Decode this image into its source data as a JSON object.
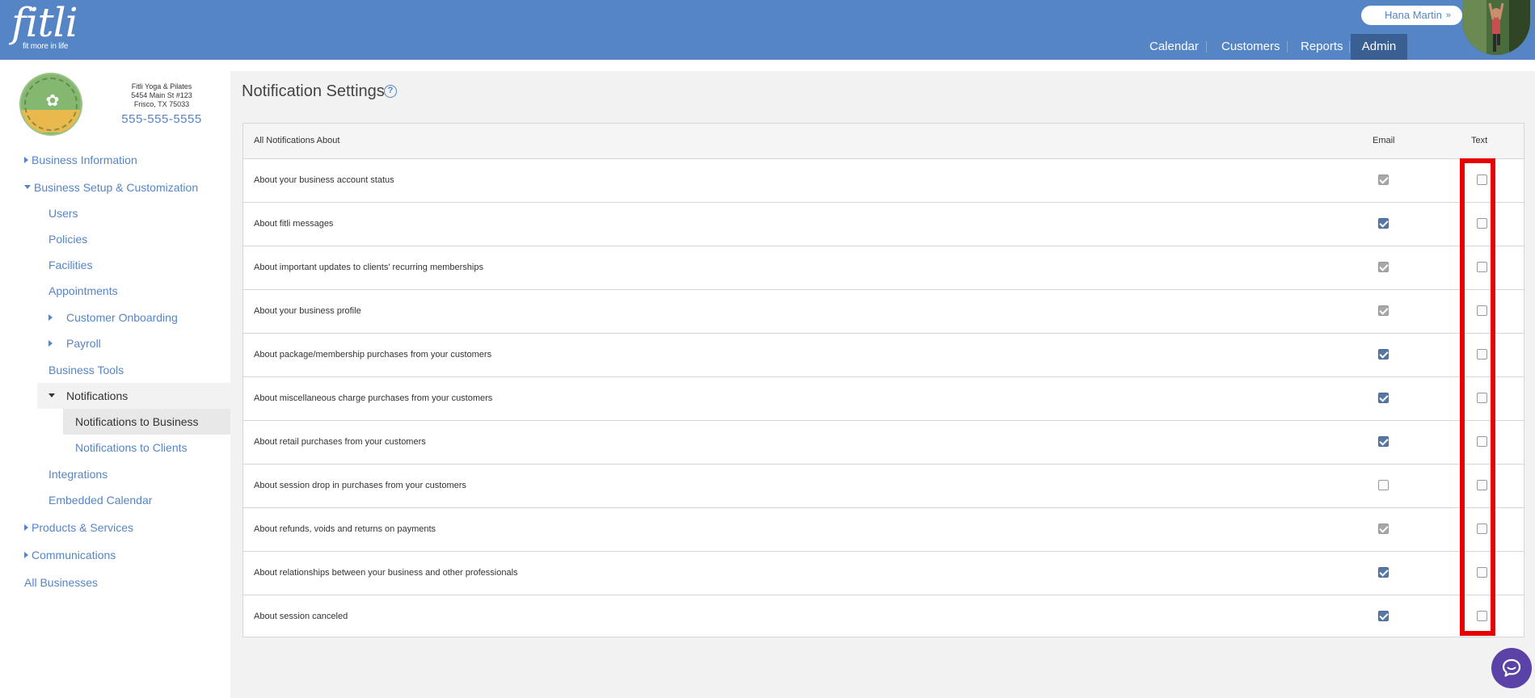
{
  "header": {
    "logo_text": "fitli",
    "logo_tagline": "fit more in life",
    "user_name": "Hana Martin",
    "user_chevron": "»",
    "nav": [
      "Calendar",
      "Customers",
      "Reports",
      "Admin"
    ],
    "active_nav": "Admin"
  },
  "business": {
    "name": "Fitli Yoga & Pilates",
    "address1": "5454 Main St #123",
    "address2": "Frisco, TX 75033",
    "phone": "555-555-5555"
  },
  "sidebar": {
    "business_information": "Business Information",
    "business_setup": "Business Setup & Customization",
    "users": "Users",
    "policies": "Policies",
    "facilities": "Facilities",
    "appointments": "Appointments",
    "customer_onboarding": "Customer Onboarding",
    "payroll": "Payroll",
    "business_tools": "Business Tools",
    "notifications": "Notifications",
    "notifications_to_business": "Notifications to Business",
    "notifications_to_clients": "Notifications to Clients",
    "integrations": "Integrations",
    "embedded_calendar": "Embedded Calendar",
    "products_services": "Products & Services",
    "communications": "Communications",
    "all_businesses": "All Businesses"
  },
  "main": {
    "title": "Notification Settings",
    "help_icon": "?",
    "table": {
      "col_label": "All Notifications About",
      "col_email": "Email",
      "col_text": "Text",
      "rows": [
        {
          "label": "About your business account status",
          "email": "checked-disabled",
          "text": false
        },
        {
          "label": "About fitli messages",
          "email": "checked",
          "text": false
        },
        {
          "label": "About important updates to clients' recurring memberships",
          "email": "checked-disabled",
          "text": false
        },
        {
          "label": "About your business profile",
          "email": "checked-disabled",
          "text": false
        },
        {
          "label": "About package/membership purchases from your customers",
          "email": "checked",
          "text": false
        },
        {
          "label": "About miscellaneous charge purchases from your customers",
          "email": "checked",
          "text": false
        },
        {
          "label": "About retail purchases from your customers",
          "email": "checked",
          "text": false
        },
        {
          "label": "About session drop in purchases from your customers",
          "email": "unchecked",
          "text": false
        },
        {
          "label": "About refunds, voids and returns on payments",
          "email": "checked-disabled",
          "text": false
        },
        {
          "label": "About relationships between your business and other professionals",
          "email": "checked",
          "text": false
        },
        {
          "label": "About session canceled",
          "email": "checked",
          "text": false
        }
      ]
    }
  },
  "colors": {
    "header_bg": "#5585c5",
    "active_nav_bg": "#3a5f93",
    "highlight_box": "#e60000",
    "chat_button": "#5a42a6"
  },
  "icons": {
    "help": "help-circle-icon",
    "chat": "chat-bubble-icon",
    "expand": "triangle-right-icon",
    "collapse": "triangle-down-icon"
  }
}
